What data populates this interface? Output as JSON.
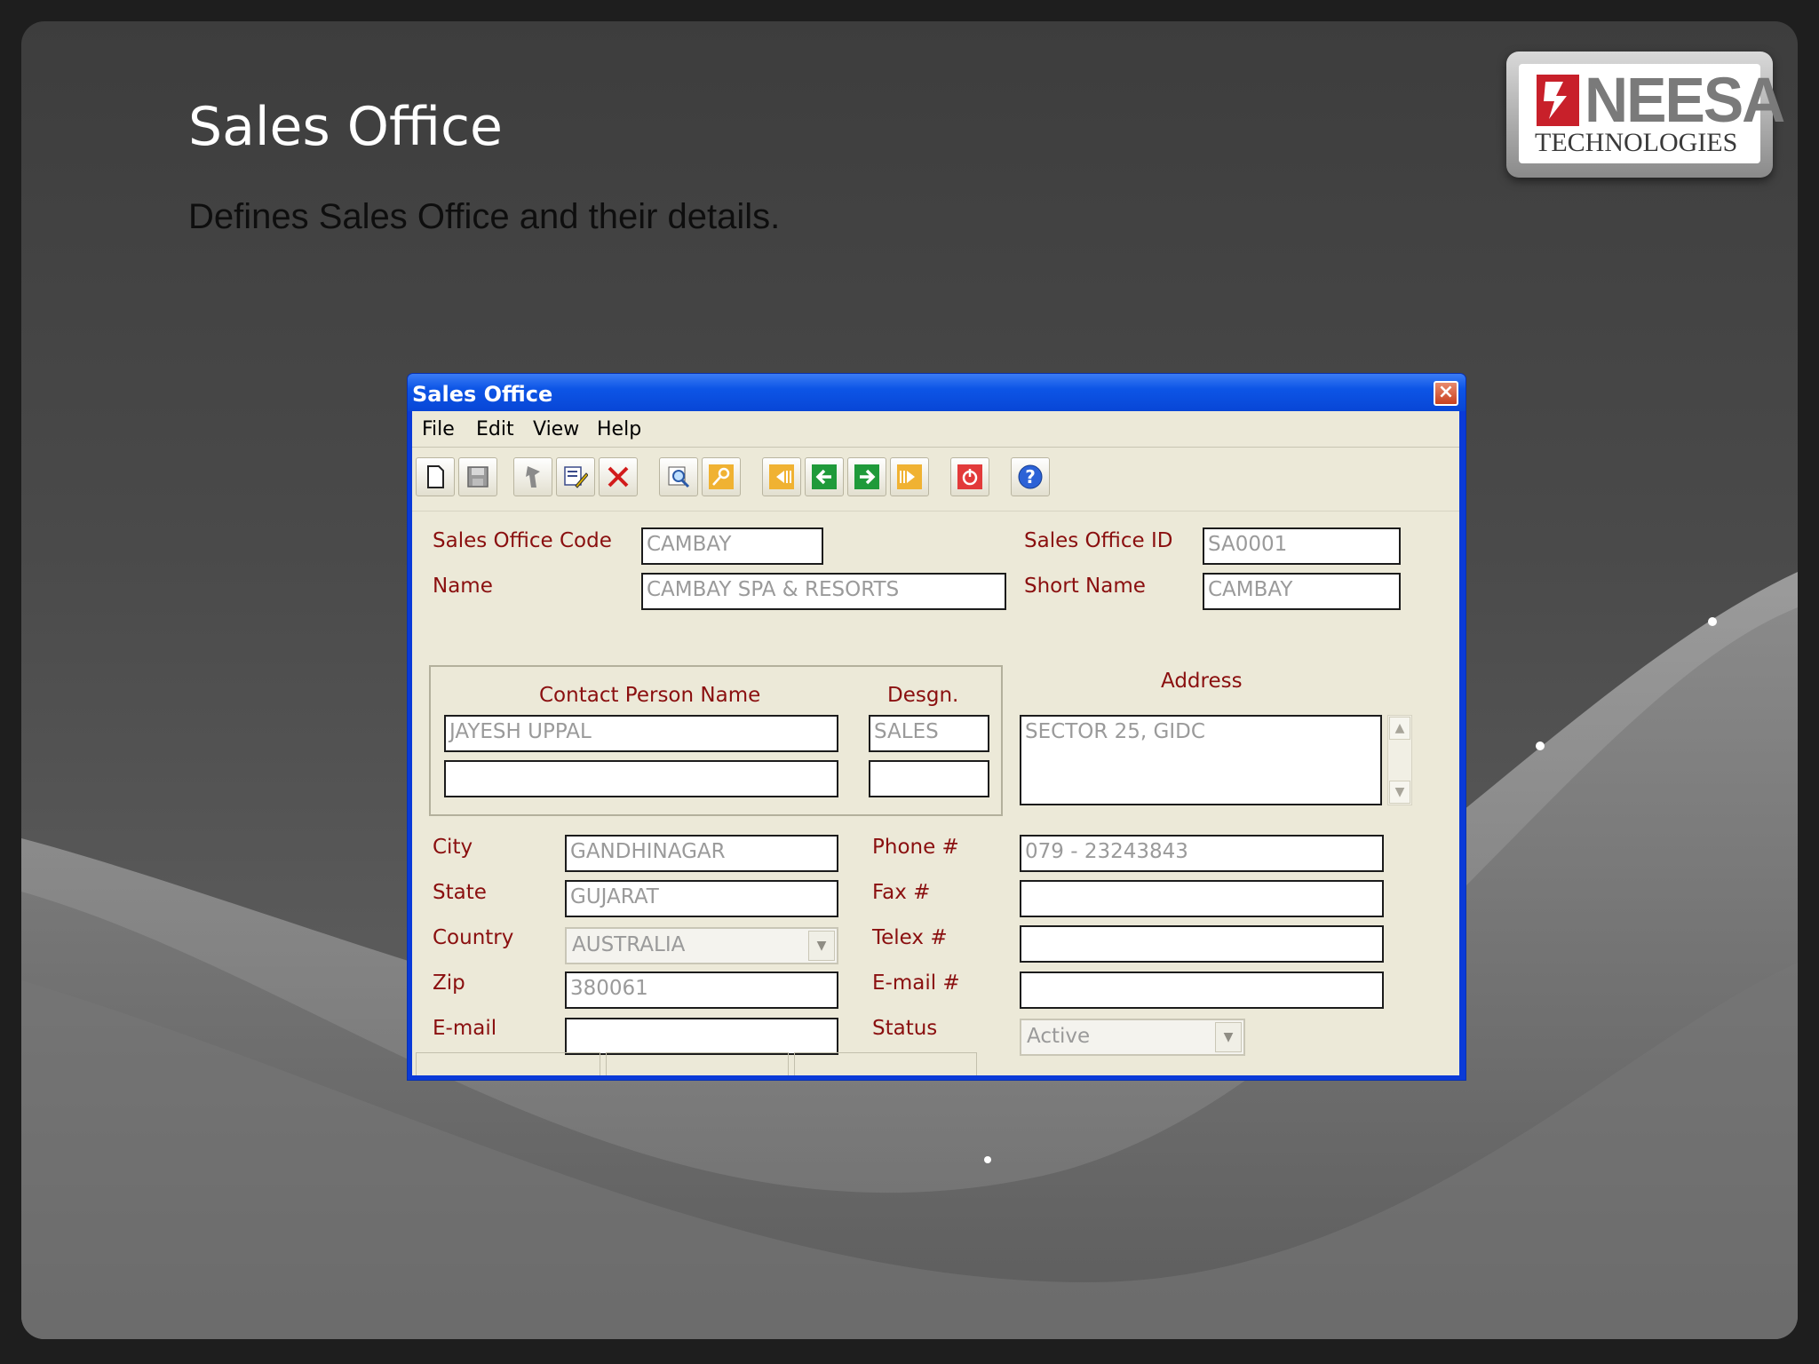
{
  "slide": {
    "title": "Sales Office",
    "subtitle": "Defines Sales Office and their details.",
    "logo_text_main": "NEESA",
    "logo_text_sub": "TECHNOLOGIES"
  },
  "window": {
    "title": "Sales Office",
    "close_label": "×"
  },
  "menu": [
    "File",
    "Edit",
    "View",
    "Help"
  ],
  "toolbar": {
    "buttons": [
      "new-icon",
      "save-icon",
      "undo-icon",
      "edit-icon",
      "delete-icon",
      "find-icon",
      "key-icon",
      "first-record-icon",
      "previous-record-icon",
      "next-record-icon",
      "last-record-icon",
      "stop-icon",
      "help-icon"
    ]
  },
  "form": {
    "sales_office_code": {
      "label": "Sales Office Code",
      "value": "CAMBAY"
    },
    "sales_office_id": {
      "label": "Sales Office ID",
      "value": "SA0001"
    },
    "name": {
      "label": "Name",
      "value": "CAMBAY SPA & RESORTS"
    },
    "short_name": {
      "label": "Short Name",
      "value": "CAMBAY"
    },
    "contact": {
      "name_header": "Contact Person Name",
      "desgn_header": "Desgn.",
      "rows": [
        {
          "name": "JAYESH UPPAL",
          "desgn": "SALES"
        },
        {
          "name": "",
          "desgn": ""
        }
      ]
    },
    "address": {
      "label": "Address",
      "value": "SECTOR 25, GIDC"
    },
    "city": {
      "label": "City",
      "value": "GANDHINAGAR"
    },
    "state": {
      "label": "State",
      "value": "GUJARAT"
    },
    "country": {
      "label": "Country",
      "value": "AUSTRALIA"
    },
    "zip": {
      "label": "Zip",
      "value": "380061"
    },
    "email": {
      "label": "E-mail",
      "value": ""
    },
    "phone": {
      "label": "Phone #",
      "value": "079 - 23243843"
    },
    "fax": {
      "label": "Fax #",
      "value": ""
    },
    "telex": {
      "label": "Telex #",
      "value": ""
    },
    "email_no": {
      "label": "E-mail #",
      "value": ""
    },
    "status": {
      "label": "Status",
      "value": "Active"
    }
  },
  "colors": {
    "label": "#8a0f0f",
    "window_blue": "#0a3ad8",
    "client_bg": "#ece9d8"
  }
}
